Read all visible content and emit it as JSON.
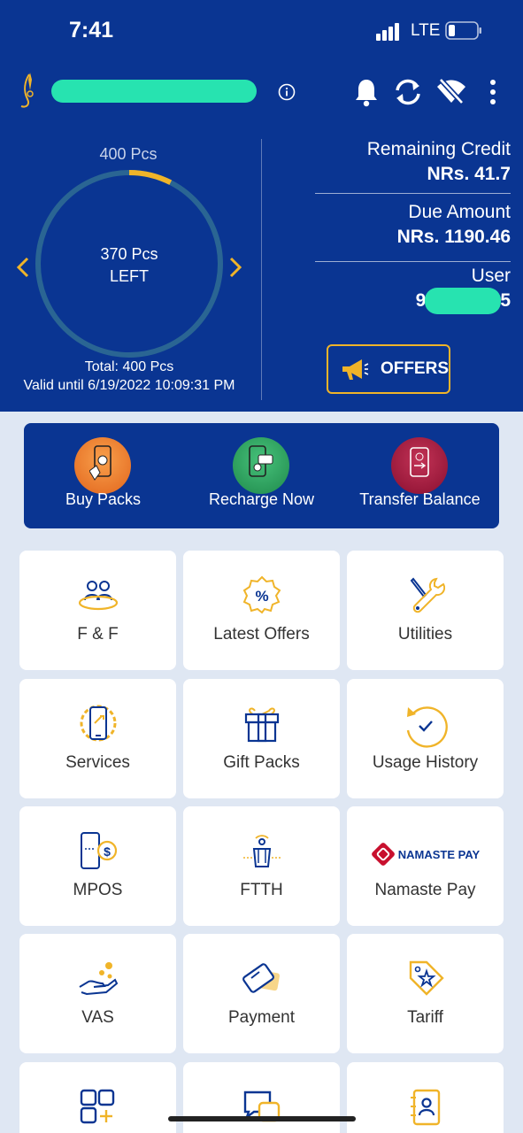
{
  "status_bar": {
    "time": "7:41",
    "network": "LTE"
  },
  "header": {
    "colors": {
      "bg": "#0a3592",
      "accent": "#f0b429",
      "ring": "#2a6593"
    }
  },
  "pack": {
    "top_label": "400 Pcs",
    "center_line1": "370 Pcs",
    "center_line2": "LEFT",
    "used_fraction": 0.075,
    "total": "Total: 400  Pcs",
    "valid_until": "Valid until 6/19/2022 10:09:31 PM"
  },
  "account": {
    "remaining_credit_label": "Remaining Credit",
    "remaining_credit_value": "NRs. 41.7",
    "due_amount_label": "Due Amount",
    "due_amount_value": "NRs. 1190.46",
    "user_label": "User",
    "user_value_start": "9",
    "user_value_end": "5"
  },
  "offers_button": {
    "label": "OFFERS"
  },
  "quick_actions": [
    {
      "label": "Buy Packs",
      "icon": "buy-packs-icon",
      "color": "#ef7d28"
    },
    {
      "label": "Recharge Now",
      "icon": "recharge-now-icon",
      "color": "#2e9f5c"
    },
    {
      "label": "Transfer Balance",
      "icon": "transfer-balance-icon",
      "color": "#a3163e"
    }
  ],
  "tiles": [
    {
      "label": "F & F",
      "icon": "friends-family-icon"
    },
    {
      "label": "Latest Offers",
      "icon": "percent-badge-icon"
    },
    {
      "label": "Utilities",
      "icon": "wrench-tools-icon"
    },
    {
      "label": "Services",
      "icon": "phone-gear-icon"
    },
    {
      "label": "Gift Packs",
      "icon": "gift-box-icon"
    },
    {
      "label": "Usage History",
      "icon": "history-check-icon"
    },
    {
      "label": "MPOS",
      "icon": "mpos-phone-dollar-icon"
    },
    {
      "label": "FTTH",
      "icon": "ftth-fiber-icon"
    },
    {
      "label": "Namaste Pay",
      "icon": "namaste-pay-logo",
      "logo_text": "NAMASTE PAY"
    },
    {
      "label": "VAS",
      "icon": "hand-coins-icon"
    },
    {
      "label": "Payment",
      "icon": "payment-card-icon"
    },
    {
      "label": "Tariff",
      "icon": "price-tag-icon"
    },
    {
      "label": "",
      "icon": "grid-add-icon"
    },
    {
      "label": "",
      "icon": "chat-bubbles-icon"
    },
    {
      "label": "",
      "icon": "contact-book-icon"
    }
  ]
}
